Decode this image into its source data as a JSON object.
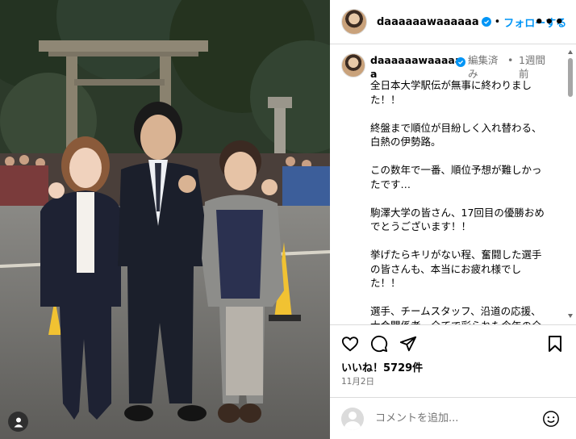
{
  "post": {
    "username": "daaaaaawaaaaaa",
    "username_wrapped_1": "daaaaaawaaaaa",
    "username_wrapped_2": "a",
    "separator": "•",
    "follow_label": "フォローする",
    "more_label": "•••",
    "edited_label_1": "編集済",
    "edited_label_2": "み",
    "time_label_1": "1週間",
    "time_label_2": "前",
    "caption": "全日本大学駅伝が無事に終わりまし\nた！！\n\n終盤まで順位が目紛しく入れ替わる、\n白熱の伊勢路。\n\nこの数年で一番、順位予想が難しかっ\nたです…\n\n駒澤大学の皆さん、17回目の優勝おめ\nでとうございます！！\n\n挙げたらキリがない程、奮闘した選手\nの皆さんも、本当にお疲れ様でし\nた！！\n\n選手、チームスタッフ、沿道の応援、\n大会関係者、全てで彩られた今年の全\n日本大学駅伝は、とても美しかったで",
    "likes_label": "いいね！5729件",
    "date_label": "11月2日",
    "comment_placeholder": "コメントを追加..."
  },
  "icons": {
    "verified": "verified-badge-icon",
    "like": "heart-icon",
    "comment": "comment-icon",
    "share": "share-icon",
    "save": "bookmark-icon",
    "emoji": "emoji-icon",
    "user_tag": "user-tag-icon"
  },
  "colors": {
    "accent": "#0095f6",
    "secondary_text": "#737373",
    "divider": "#dbdbdb"
  }
}
